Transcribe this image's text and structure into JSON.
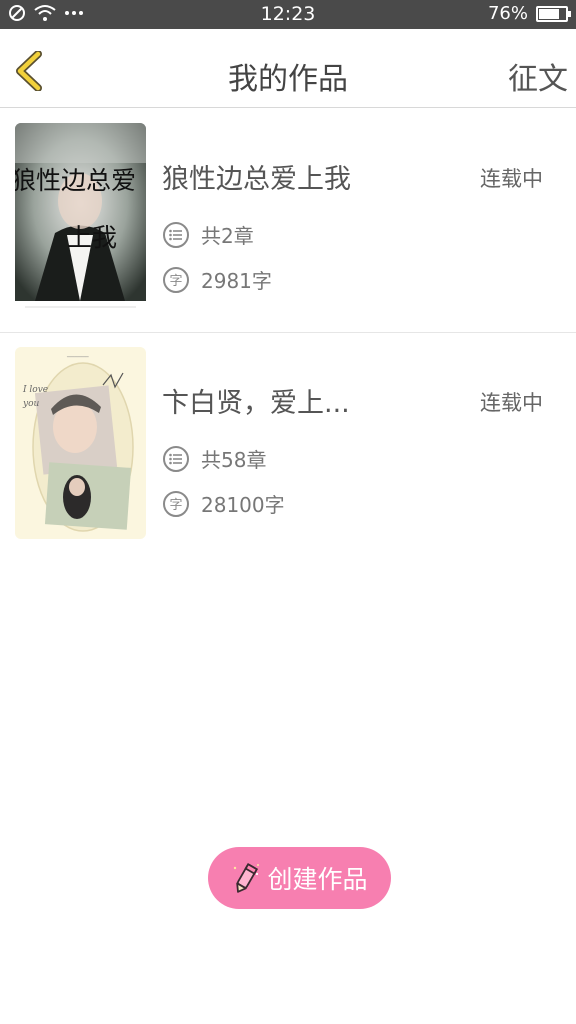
{
  "status_bar": {
    "time": "12:23",
    "battery": "76%",
    "battery_level": 0.76,
    "icons": [
      "no-sim-icon",
      "wifi-icon",
      "more-dots-icon",
      "battery-icon"
    ]
  },
  "header": {
    "title": "我的作品",
    "action": "征文",
    "back_icon": "chevron-left-icon",
    "back_color": "#f2d13b"
  },
  "works": [
    {
      "title": "狼性边总爱上我",
      "status": "连载中",
      "chapters": "共2章",
      "words": "2981字",
      "cover_text": [
        "狼性边总爱",
        "上我"
      ]
    },
    {
      "title": "卞白贤，爱上...",
      "status": "连载中",
      "chapters": "共58章",
      "words": "28100字",
      "cover_text": [
        "I love you"
      ]
    }
  ],
  "create_button": {
    "label": "创建作品",
    "color": "#f77fb0",
    "icon": "pencil-icon"
  },
  "meta_icons": {
    "chapters": "list-icon",
    "words": "character-icon",
    "words_glyph": "字"
  }
}
